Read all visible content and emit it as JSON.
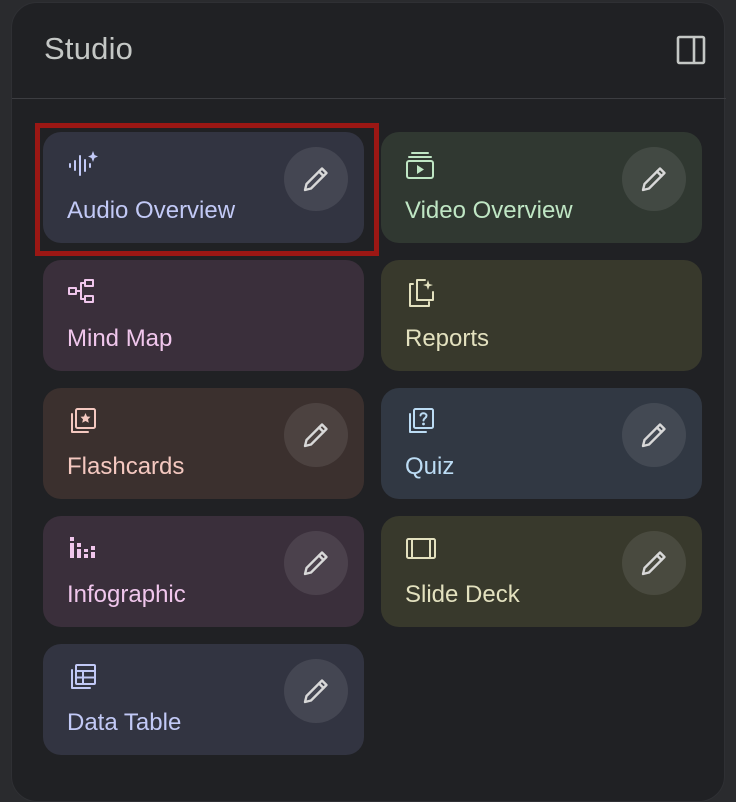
{
  "panel": {
    "title": "Studio",
    "toggle_icon": "side-panel-icon"
  },
  "cards": [
    {
      "id": "audio-overview",
      "label": "Audio Overview",
      "icon": "audio-waveform-sparkle-icon",
      "bg": "#323441",
      "fg": "#c2c9f6",
      "edit": true,
      "highlighted": true
    },
    {
      "id": "video-overview",
      "label": "Video Overview",
      "icon": "video-play-stack-icon",
      "bg": "#303831",
      "fg": "#bfe6c4",
      "edit": true
    },
    {
      "id": "mind-map",
      "label": "Mind Map",
      "icon": "mind-map-icon",
      "bg": "#3a2f3b",
      "fg": "#f0c6ec",
      "edit": false
    },
    {
      "id": "reports",
      "label": "Reports",
      "icon": "reports-sparkle-icon",
      "bg": "#38392c",
      "fg": "#e3e1bf",
      "edit": false
    },
    {
      "id": "flashcards",
      "label": "Flashcards",
      "icon": "flashcards-star-icon",
      "bg": "#3b302e",
      "fg": "#f4c8c0",
      "edit": true
    },
    {
      "id": "quiz",
      "label": "Quiz",
      "icon": "quiz-question-icon",
      "bg": "#313843",
      "fg": "#bcdcf4",
      "edit": true
    },
    {
      "id": "infographic",
      "label": "Infographic",
      "icon": "infographic-bars-icon",
      "bg": "#3a2f3b",
      "fg": "#f0c6ec",
      "edit": true
    },
    {
      "id": "slide-deck",
      "label": "Slide Deck",
      "icon": "slide-deck-icon",
      "bg": "#38392c",
      "fg": "#e3e1bf",
      "edit": true
    },
    {
      "id": "data-table",
      "label": "Data Table",
      "icon": "data-table-icon",
      "bg": "#323441",
      "fg": "#c2c9f6",
      "edit": true
    }
  ],
  "edit_icon": "pencil-icon",
  "colors": {
    "panel_bg": "#202124",
    "title": "#c4c7c5",
    "highlight": "#9b1714"
  }
}
